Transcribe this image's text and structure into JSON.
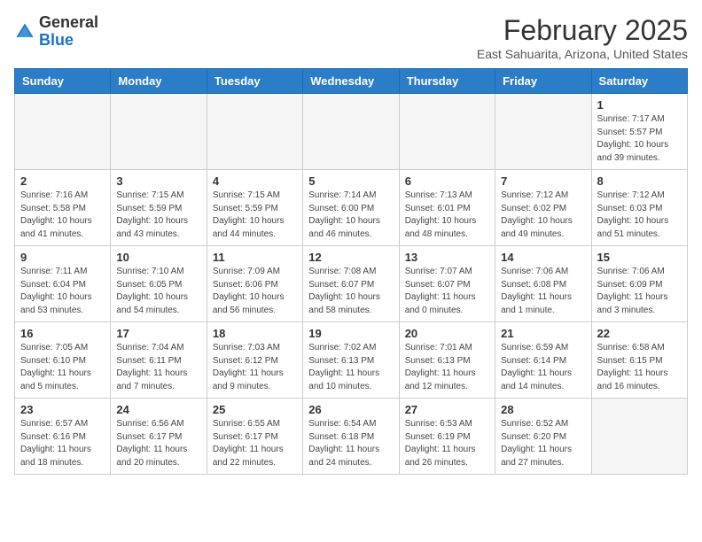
{
  "header": {
    "logo_line1": "General",
    "logo_line2": "Blue",
    "month_title": "February 2025",
    "location": "East Sahuarita, Arizona, United States"
  },
  "weekdays": [
    "Sunday",
    "Monday",
    "Tuesday",
    "Wednesday",
    "Thursday",
    "Friday",
    "Saturday"
  ],
  "weeks": [
    [
      {
        "day": "",
        "info": ""
      },
      {
        "day": "",
        "info": ""
      },
      {
        "day": "",
        "info": ""
      },
      {
        "day": "",
        "info": ""
      },
      {
        "day": "",
        "info": ""
      },
      {
        "day": "",
        "info": ""
      },
      {
        "day": "1",
        "info": "Sunrise: 7:17 AM\nSunset: 5:57 PM\nDaylight: 10 hours\nand 39 minutes."
      }
    ],
    [
      {
        "day": "2",
        "info": "Sunrise: 7:16 AM\nSunset: 5:58 PM\nDaylight: 10 hours\nand 41 minutes."
      },
      {
        "day": "3",
        "info": "Sunrise: 7:15 AM\nSunset: 5:59 PM\nDaylight: 10 hours\nand 43 minutes."
      },
      {
        "day": "4",
        "info": "Sunrise: 7:15 AM\nSunset: 5:59 PM\nDaylight: 10 hours\nand 44 minutes."
      },
      {
        "day": "5",
        "info": "Sunrise: 7:14 AM\nSunset: 6:00 PM\nDaylight: 10 hours\nand 46 minutes."
      },
      {
        "day": "6",
        "info": "Sunrise: 7:13 AM\nSunset: 6:01 PM\nDaylight: 10 hours\nand 48 minutes."
      },
      {
        "day": "7",
        "info": "Sunrise: 7:12 AM\nSunset: 6:02 PM\nDaylight: 10 hours\nand 49 minutes."
      },
      {
        "day": "8",
        "info": "Sunrise: 7:12 AM\nSunset: 6:03 PM\nDaylight: 10 hours\nand 51 minutes."
      }
    ],
    [
      {
        "day": "9",
        "info": "Sunrise: 7:11 AM\nSunset: 6:04 PM\nDaylight: 10 hours\nand 53 minutes."
      },
      {
        "day": "10",
        "info": "Sunrise: 7:10 AM\nSunset: 6:05 PM\nDaylight: 10 hours\nand 54 minutes."
      },
      {
        "day": "11",
        "info": "Sunrise: 7:09 AM\nSunset: 6:06 PM\nDaylight: 10 hours\nand 56 minutes."
      },
      {
        "day": "12",
        "info": "Sunrise: 7:08 AM\nSunset: 6:07 PM\nDaylight: 10 hours\nand 58 minutes."
      },
      {
        "day": "13",
        "info": "Sunrise: 7:07 AM\nSunset: 6:07 PM\nDaylight: 11 hours\nand 0 minutes."
      },
      {
        "day": "14",
        "info": "Sunrise: 7:06 AM\nSunset: 6:08 PM\nDaylight: 11 hours\nand 1 minute."
      },
      {
        "day": "15",
        "info": "Sunrise: 7:06 AM\nSunset: 6:09 PM\nDaylight: 11 hours\nand 3 minutes."
      }
    ],
    [
      {
        "day": "16",
        "info": "Sunrise: 7:05 AM\nSunset: 6:10 PM\nDaylight: 11 hours\nand 5 minutes."
      },
      {
        "day": "17",
        "info": "Sunrise: 7:04 AM\nSunset: 6:11 PM\nDaylight: 11 hours\nand 7 minutes."
      },
      {
        "day": "18",
        "info": "Sunrise: 7:03 AM\nSunset: 6:12 PM\nDaylight: 11 hours\nand 9 minutes."
      },
      {
        "day": "19",
        "info": "Sunrise: 7:02 AM\nSunset: 6:13 PM\nDaylight: 11 hours\nand 10 minutes."
      },
      {
        "day": "20",
        "info": "Sunrise: 7:01 AM\nSunset: 6:13 PM\nDaylight: 11 hours\nand 12 minutes."
      },
      {
        "day": "21",
        "info": "Sunrise: 6:59 AM\nSunset: 6:14 PM\nDaylight: 11 hours\nand 14 minutes."
      },
      {
        "day": "22",
        "info": "Sunrise: 6:58 AM\nSunset: 6:15 PM\nDaylight: 11 hours\nand 16 minutes."
      }
    ],
    [
      {
        "day": "23",
        "info": "Sunrise: 6:57 AM\nSunset: 6:16 PM\nDaylight: 11 hours\nand 18 minutes."
      },
      {
        "day": "24",
        "info": "Sunrise: 6:56 AM\nSunset: 6:17 PM\nDaylight: 11 hours\nand 20 minutes."
      },
      {
        "day": "25",
        "info": "Sunrise: 6:55 AM\nSunset: 6:17 PM\nDaylight: 11 hours\nand 22 minutes."
      },
      {
        "day": "26",
        "info": "Sunrise: 6:54 AM\nSunset: 6:18 PM\nDaylight: 11 hours\nand 24 minutes."
      },
      {
        "day": "27",
        "info": "Sunrise: 6:53 AM\nSunset: 6:19 PM\nDaylight: 11 hours\nand 26 minutes."
      },
      {
        "day": "28",
        "info": "Sunrise: 6:52 AM\nSunset: 6:20 PM\nDaylight: 11 hours\nand 27 minutes."
      },
      {
        "day": "",
        "info": ""
      }
    ]
  ]
}
